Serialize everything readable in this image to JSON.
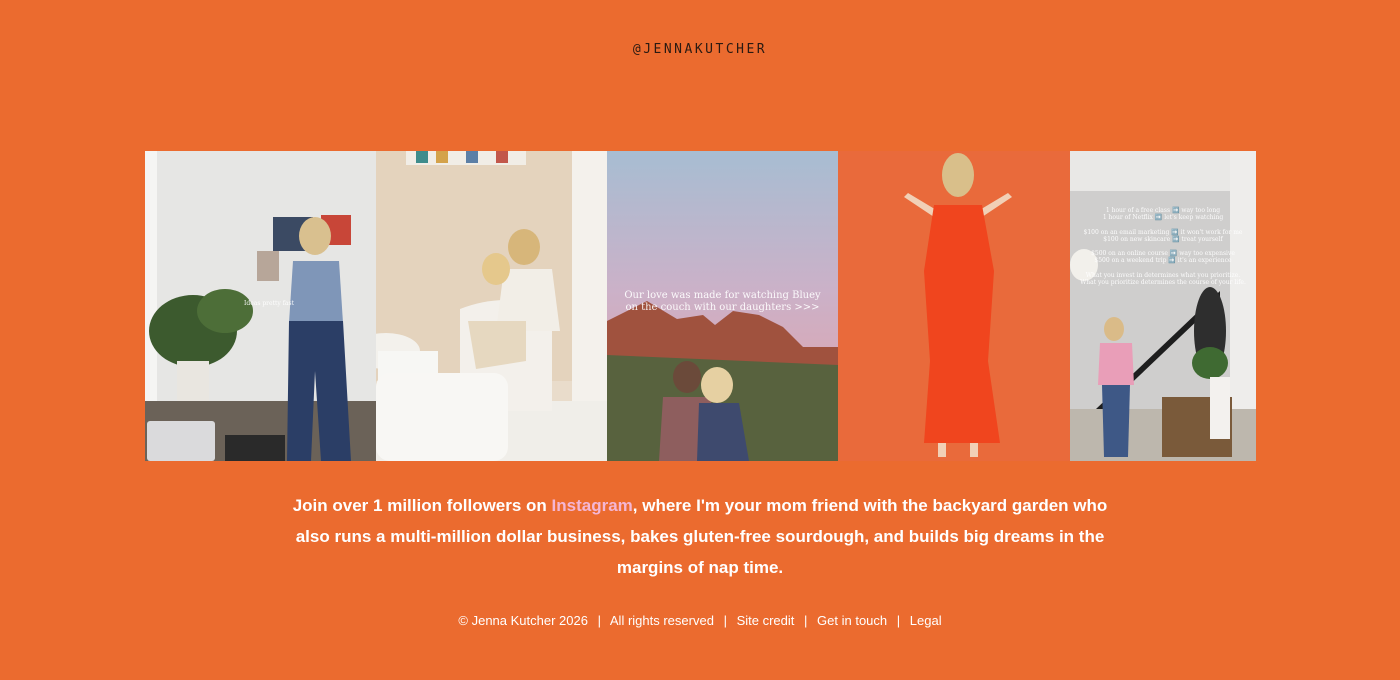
{
  "header": {
    "handle": "@JENNAKUTCHER"
  },
  "gallery": {
    "tiles": [
      {
        "icon": "photo-woman-wall-collage",
        "caption": "Ideas pretty fast"
      },
      {
        "icon": "photo-mother-child-armchair",
        "caption": ""
      },
      {
        "icon": "photo-couple-canyon-sunset",
        "caption": "Our love was made for watching Bluey on the couch with our daughters >>>"
      },
      {
        "icon": "photo-woman-orange-dress",
        "caption": ""
      },
      {
        "icon": "photo-woman-staircase-hallway",
        "caption": "1 hour of a free class ➡️ way too long\n1 hour of Netflix ➡️ let's keep watching\n\n$100 on an email marketing ➡️ it won't work for me\n$100 on new skincare ➡️ treat yourself\n\n$500 on an online course ➡️ way too expensive\n$500 on a weekend trip ➡️ it's an experience\n\nWhat you invest in determines what you prioritize. What you prioritize determines the course of your life."
      }
    ]
  },
  "tagline": {
    "before": "Join over 1 million followers on ",
    "link": "Instagram",
    "after": ", where I'm your mom friend with the backyard garden who also runs a multi-million dollar business, bakes gluten-free sourdough, and builds big dreams in the margins of nap time."
  },
  "footer": {
    "copyright": "© Jenna Kutcher 2026",
    "separator": "|",
    "rights": "All rights reserved",
    "site_credit": "Site credit",
    "contact": "Get in touch",
    "legal": "Legal"
  },
  "colors": {
    "background": "#EB6B2F",
    "link_accent": "#F4B6D4",
    "handle_text": "#2A1A12"
  }
}
